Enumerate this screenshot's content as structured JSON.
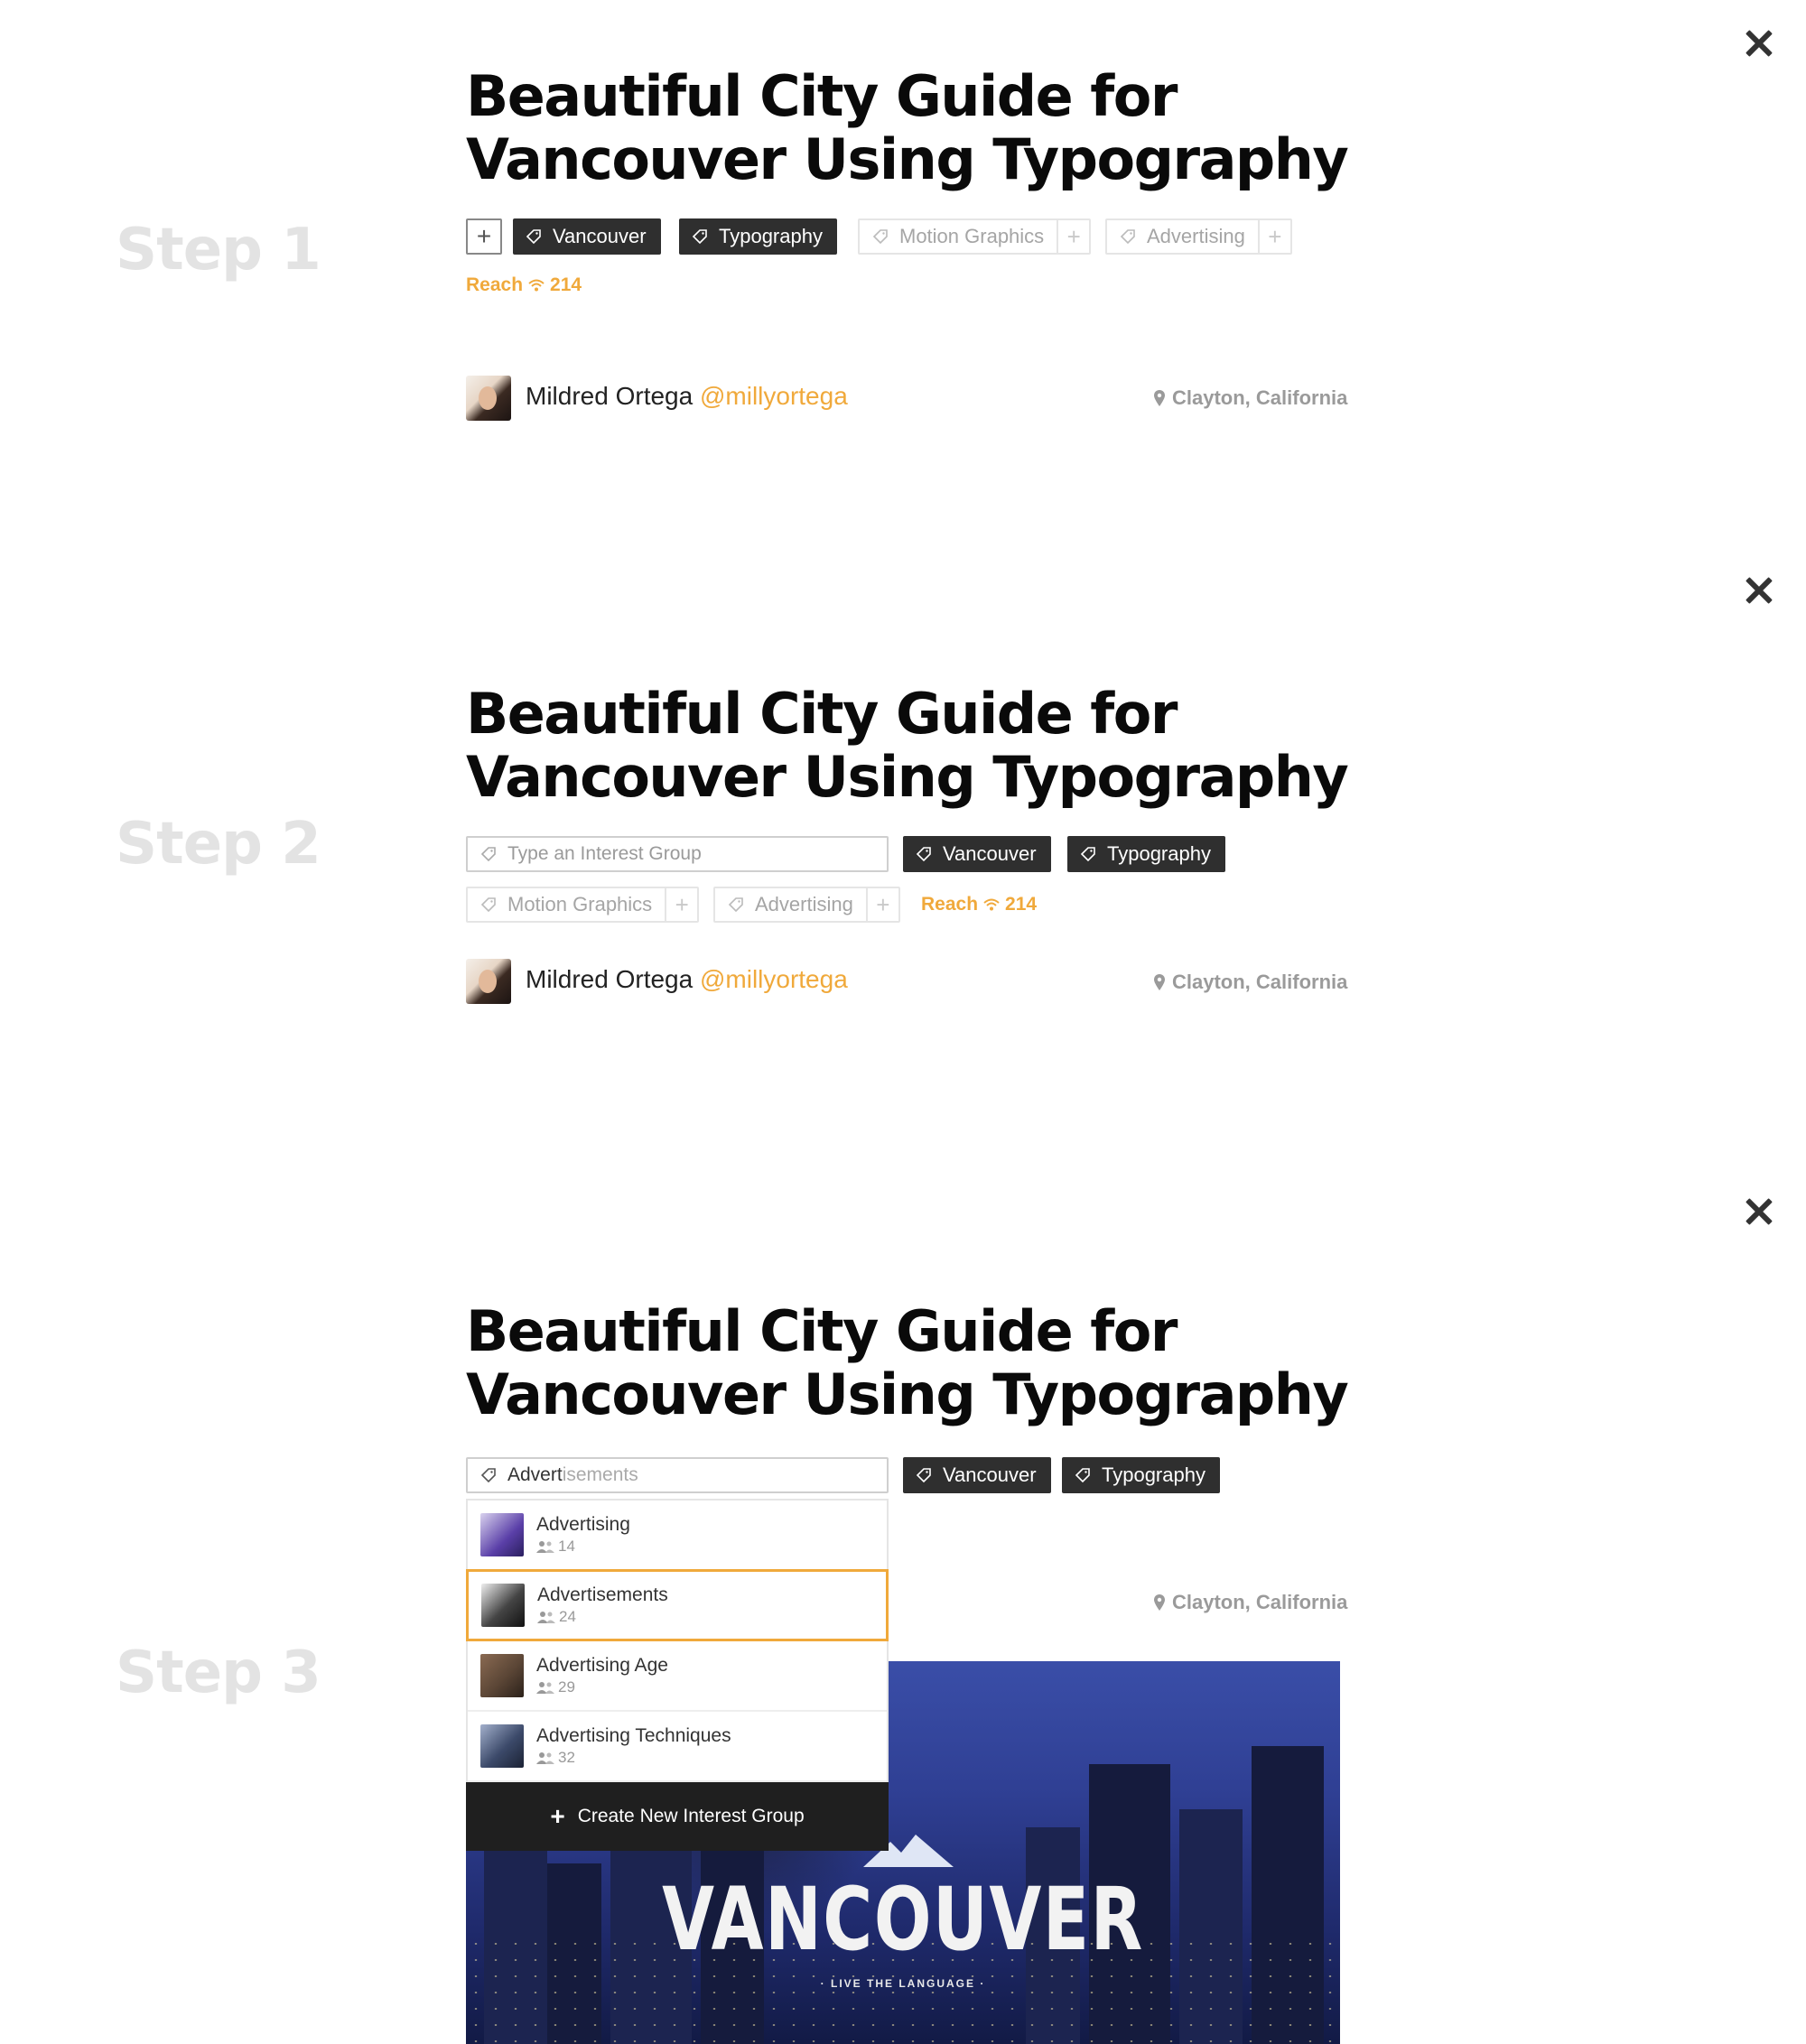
{
  "steps": [
    {
      "label": "Step 1",
      "title_line1": "Beautiful City Guide for",
      "title_line2": "Vancouver Using Typography",
      "tags_active": [
        "Vancouver",
        "Typography"
      ],
      "tags_suggested": [
        "Motion Graphics",
        "Advertising"
      ],
      "reach_label": "Reach",
      "reach_value": "214",
      "author_name": "Mildred Ortega",
      "author_handle": "@millyortega",
      "location": "Clayton, California"
    },
    {
      "label": "Step 2",
      "title_line1": "Beautiful City Guide for",
      "title_line2": "Vancouver Using Typography",
      "input_placeholder": "Type an Interest Group",
      "tags_active": [
        "Vancouver",
        "Typography"
      ],
      "tags_suggested": [
        "Motion Graphics",
        "Advertising"
      ],
      "reach_label": "Reach",
      "reach_value": "214",
      "author_name": "Mildred Ortega",
      "author_handle": "@millyortega",
      "location": "Clayton, California"
    },
    {
      "label": "Step 3",
      "title_line1": "Beautiful City Guide for",
      "title_line2": "Vancouver Using Typography",
      "input_typed": "Advert",
      "input_suggest": "isements",
      "tags_active": [
        "Vancouver",
        "Typography"
      ],
      "location": "Clayton, California",
      "dropdown": [
        {
          "name": "Advertising",
          "count": "14",
          "thumb": "#5a3fa8"
        },
        {
          "name": "Advertisements",
          "count": "24",
          "thumb": "#2a2a2a"
        },
        {
          "name": "Advertising Age",
          "count": "29",
          "thumb": "#5b4636"
        },
        {
          "name": "Advertising Techniques",
          "count": "32",
          "thumb": "#3c4a6a"
        }
      ],
      "dropdown_selected": "Advertisements",
      "create_label": "Create New Interest Group",
      "hero_title": "VANCOUVER",
      "hero_subtitle": "· LIVE THE LANGUAGE ·"
    }
  ],
  "colors": {
    "accent": "#f0a93b",
    "tag_dark": "#2f2f2f",
    "step_label": "#e3e3e3"
  },
  "icons": {
    "close": "close-icon",
    "tag": "tag-icon",
    "plus": "plus-icon",
    "reach": "wifi-icon",
    "location": "location-pin-icon",
    "members": "people-icon"
  }
}
